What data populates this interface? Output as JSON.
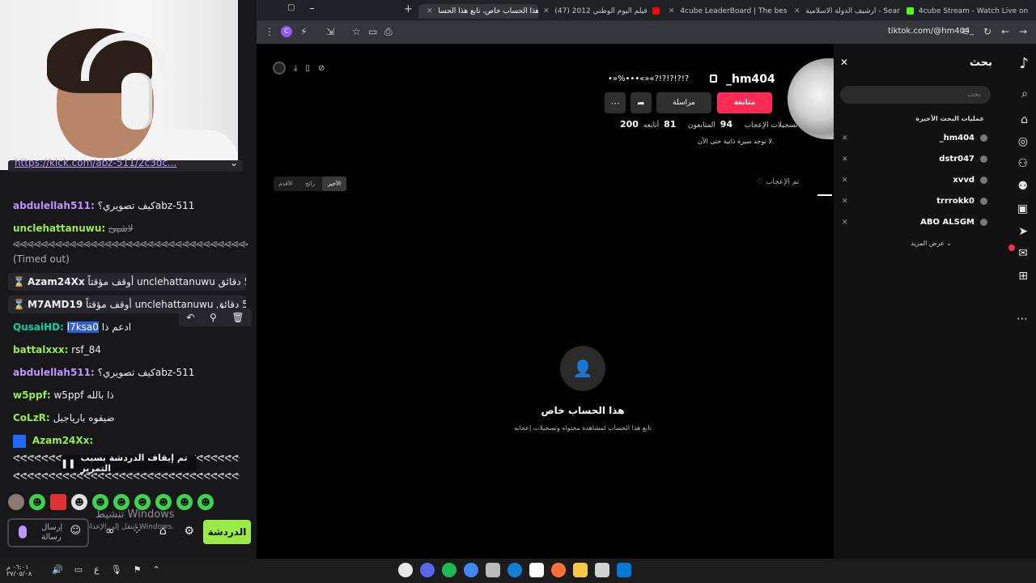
{
  "chat": {
    "pinned_link": "https://kick.com/abz-511/2c3dc...",
    "messages": [
      {
        "user": "abdulellah511:",
        "text": "كيف تصويري؟abz-511",
        "color": "#bf94ff"
      },
      {
        "user": "unclehattanuwu:",
        "text": "لاشيئ",
        "color": "#9aeb45"
      },
      {
        "user": "",
        "text": "(Timed out)",
        "color": "#efeff1"
      },
      {
        "user": "QusaiHD:",
        "text": "ادعم ذا",
        "mention": "l7ksa0",
        "color": "#00d4a8"
      },
      {
        "user": "battalxxx:",
        "text": "rsf_84",
        "color": "#9aeb45"
      },
      {
        "user": "abdulellah511:",
        "text": "كيف تصويري؟abz-511",
        "color": "#bf94ff"
      },
      {
        "user": "w5ppf:",
        "text": "w5ppf ذا بالله",
        "color": "#9aeb45"
      },
      {
        "user": "CoLzR:",
        "text": "ضيفوه بارياجيل",
        "color": "#9aeb45"
      },
      {
        "user": "Azam24Xx:",
        "text": "",
        "color": "#9aeb45"
      }
    ],
    "system": [
      {
        "user": "Azam24Xx",
        "text": "أوقف مؤقتاً unclehattanuwu لمدة 5 دقائق"
      },
      {
        "user": "M7AMD19",
        "text": "أوقف مؤقتاً unclehattanuwu لمدة 5 دقائق"
      }
    ],
    "spam_line": "ᕙᕙᕙᕙᕙᕙᕙᕙᕙᕙᕙᕙᕙᕙᕙᕙᕙᕙᕙᕙᕙᕙᕙᕙᕙᕙᕙᕙᕙᕙᕙᕙᕙᕙᕙᕙᕙᕙᕙᕙ",
    "paused_text": "تم إيقاف الدردشة بسبب التمرير",
    "input_placeholder": "إرسال رسالة",
    "send_label": "الدردشة",
    "windows_watermark": "تنشيط Windows",
    "windows_watermark_sub": "انتقل إلى الإعدادات لتنشيط Windows."
  },
  "browser": {
    "tabs": [
      {
        "label": "4cube Stream - Watch Live on",
        "color": "#53fc18"
      },
      {
        "label": "ارشيف الدولة الاسلامية - Search",
        "color": "#ff4500"
      },
      {
        "label": "4cube LeaderBoard | The best",
        "color": "#ffffff"
      },
      {
        "label": "(47) فيلم اليوم الوطني 2012",
        "color": "#ff0000"
      },
      {
        "label": "هذا الحساب خاص، تابع هذا الحسا",
        "color": "#ffffff",
        "active": true
      }
    ],
    "url": "tiktok.com/@hm404_"
  },
  "tiktok": {
    "search_title": "بحث",
    "search_placeholder": "بحث",
    "recent_title": "عمليات البحث الأخيرة",
    "recent": [
      "_hm404",
      "dstr047",
      "xvvd",
      "trrrokk0",
      "ABO ALSGM"
    ],
    "show_more": "عرض المزيد ⌄",
    "username": "_hm404",
    "nickname": "•»%•••«»«?!?!?!?!?",
    "follow_label": "متابعة",
    "message_label": "مراسلة",
    "following_count": "81",
    "following_label": "أتابعه",
    "followers_count": "94",
    "followers_label": "المتابعون",
    "likes_count": "200",
    "likes_label": "تسجيلات الإعجاب",
    "bio": "لا توجد سيرة ذاتية حتى الآن.",
    "liked_tab": "تم الإعجاب",
    "sort": [
      "الأقدم",
      "رائج",
      "الأخير"
    ],
    "private_title": "هذا الحساب خاص",
    "private_sub": "تابع هذا الحساب لمشاهدة محتواه وتسجيلات إعجابه"
  },
  "taskbar": {
    "time": "٠٦:٠١ م",
    "date": "٢٧/٠٥/٠٨"
  }
}
